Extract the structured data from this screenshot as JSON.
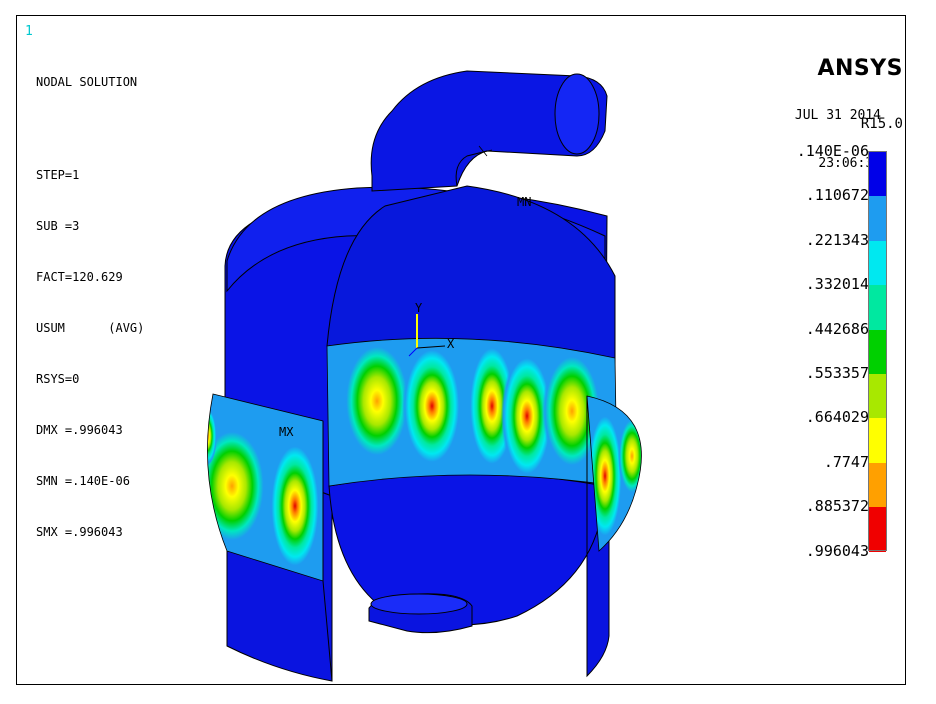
{
  "window": {
    "number": "1"
  },
  "solution": {
    "title": "NODAL SOLUTION",
    "step": "STEP=1",
    "sub": "SUB =3",
    "fact": "FACT=120.629",
    "usum": "USUM      (AVG)",
    "rsys": "RSYS=0",
    "dmx": "DMX =.996043",
    "smn": "SMN =.140E-06",
    "smx": "SMX =.996043"
  },
  "brand": {
    "name": "ANSYS",
    "version": "R15.0"
  },
  "timestamp": {
    "date": "JUL 31 2014",
    "time": "23:06:39"
  },
  "legend": {
    "labels": [
      ".140E-06",
      ".110672",
      ".221343",
      ".332014",
      ".442686",
      ".553357",
      ".664029",
      ".7747",
      ".885372",
      ".996043"
    ],
    "colors": [
      "#0000e8",
      "#1e9cf0",
      "#00e8f0",
      "#00e8a0",
      "#00d000",
      "#a8e800",
      "#ffff00",
      "#ffa000",
      "#f00000"
    ]
  },
  "markers": {
    "mn": "MN",
    "mx": "MX",
    "axis_y": "Y",
    "axis_x": "X"
  }
}
